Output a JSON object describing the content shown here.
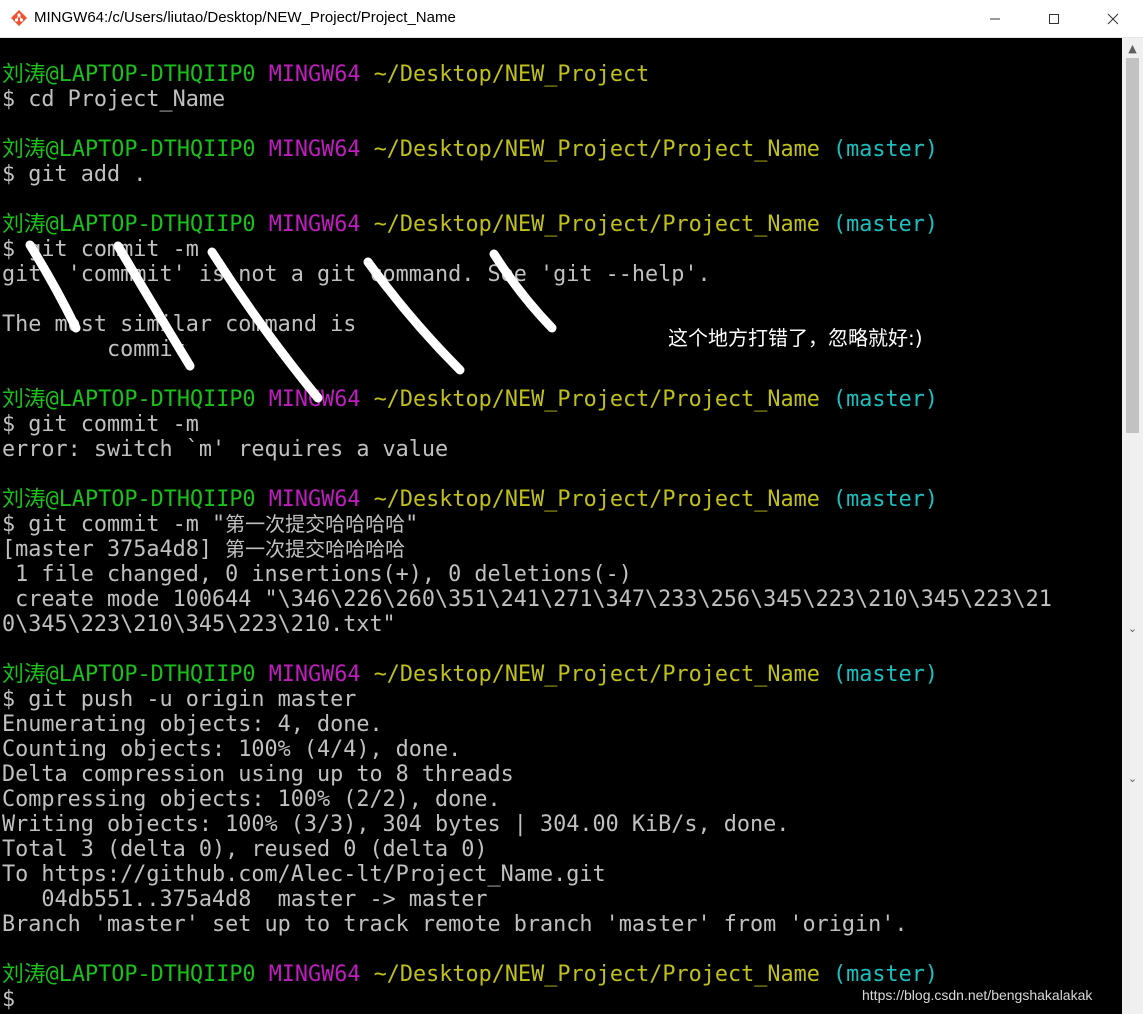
{
  "window": {
    "title": "MINGW64:/c/Users/liutao/Desktop/NEW_Project/Project_Name",
    "min_icon": "minimize-icon",
    "max_icon": "maximize-icon",
    "close_icon": "close-icon"
  },
  "prompt": {
    "user": "刘涛@LAPTOP-DTHQIIP0",
    "host": "MINGW64",
    "path_parent": "~/Desktop/NEW_Project",
    "path_project": "~/Desktop/NEW_Project/Project_Name",
    "branch": "(master)"
  },
  "terminal": {
    "cmd_cd": "$ cd Project_Name",
    "cmd_add": "$ git add .",
    "cmd_commit_bad": "$ git commit -m",
    "out_bad_1": "git: 'commmit' is not a git command. See 'git --help'.",
    "out_bad_2": "The most similar command is",
    "out_bad_3": "        commit",
    "cmd_commit_m": "$ git commit -m",
    "out_error": "error: switch `m' requires a value",
    "cmd_commit_msg_prefix": "$ git commit -m \"",
    "commit_message": "第一次提交哈哈哈哈",
    "cmd_commit_msg_suffix": "\"",
    "out_commit_prefix": "[master 375a4d8] ",
    "out_changed": " 1 file changed, 0 insertions(+), 0 deletions(-)",
    "out_create_1": " create mode 100644 \"\\346\\226\\260\\351\\241\\271\\347\\233\\256\\345\\223\\210\\345\\223\\21",
    "out_create_2": "0\\345\\223\\210\\345\\223\\210.txt\"",
    "cmd_push": "$ git push -u origin master",
    "push_lines": [
      "Enumerating objects: 4, done.",
      "Counting objects: 100% (4/4), done.",
      "Delta compression using up to 8 threads",
      "Compressing objects: 100% (2/2), done.",
      "Writing objects: 100% (3/3), 304 bytes | 304.00 KiB/s, done.",
      "Total 3 (delta 0), reused 0 (delta 0)",
      "To https://github.com/Alec-lt/Project_Name.git",
      "   04db551..375a4d8  master -> master",
      "Branch 'master' set up to track remote branch 'master' from 'origin'."
    ],
    "final_prompt": "$"
  },
  "annotation": "这个地方打错了，忽略就好:)",
  "watermark": "https://blog.csdn.net/bengshakalakak",
  "colors": {
    "user": "#1ac11a",
    "host": "#c01cc0",
    "path": "#c0c01a",
    "branch": "#1ac0c0",
    "text": "#c0c0c0",
    "background": "#000000"
  }
}
